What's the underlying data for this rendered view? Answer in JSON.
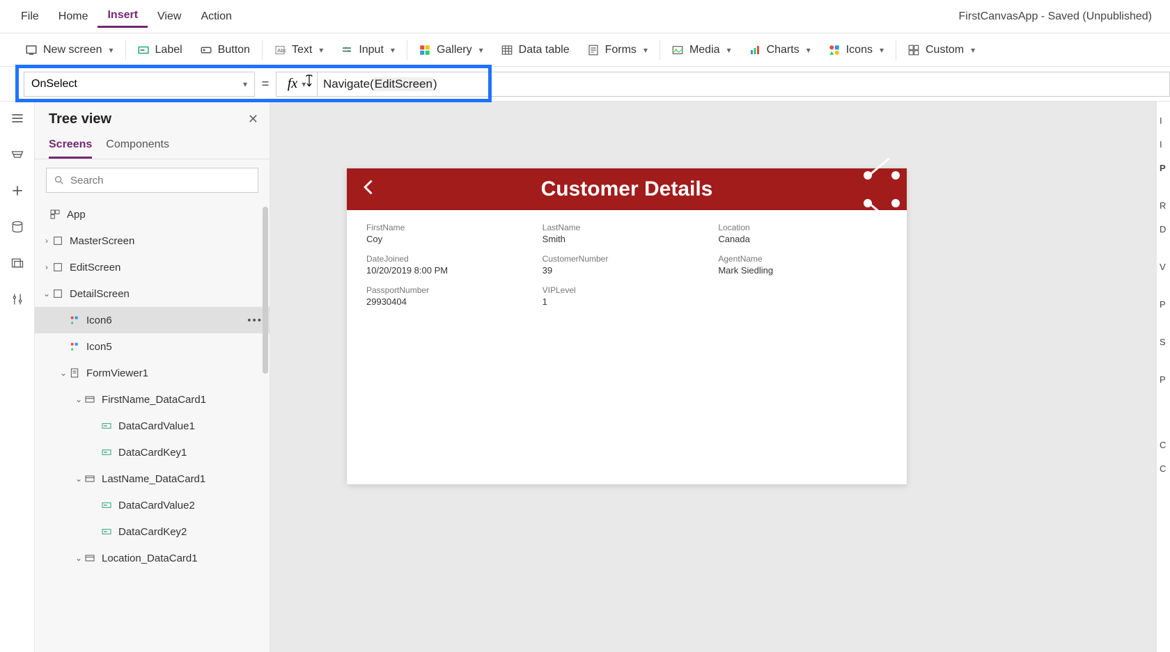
{
  "app_title": "FirstCanvasApp - Saved (Unpublished)",
  "menu": {
    "file": "File",
    "home": "Home",
    "insert": "Insert",
    "view": "View",
    "action": "Action"
  },
  "ribbon": {
    "new_screen": "New screen",
    "label": "Label",
    "button": "Button",
    "text": "Text",
    "input": "Input",
    "gallery": "Gallery",
    "data_table": "Data table",
    "forms": "Forms",
    "media": "Media",
    "charts": "Charts",
    "icons": "Icons",
    "custom": "Custom"
  },
  "formula": {
    "property": "OnSelect",
    "equals": "=",
    "fn_name": "Navigate",
    "arg": "EditScreen"
  },
  "tree": {
    "title": "Tree view",
    "tab_screens": "Screens",
    "tab_components": "Components",
    "search_placeholder": "Search",
    "app": "App",
    "master": "MasterScreen",
    "edit": "EditScreen",
    "detail": "DetailScreen",
    "icon6": "Icon6",
    "icon5": "Icon5",
    "formviewer": "FormViewer1",
    "fn_card": "FirstName_DataCard1",
    "dcv1": "DataCardValue1",
    "dck1": "DataCardKey1",
    "ln_card": "LastName_DataCard1",
    "dcv2": "DataCardValue2",
    "dck2": "DataCardKey2",
    "loc_card": "Location_DataCard1"
  },
  "preview": {
    "title": "Customer Details",
    "fields": {
      "firstname_l": "FirstName",
      "firstname_v": "Coy",
      "lastname_l": "LastName",
      "lastname_v": "Smith",
      "location_l": "Location",
      "location_v": "Canada",
      "datejoined_l": "DateJoined",
      "datejoined_v": "10/20/2019 8:00 PM",
      "custnum_l": "CustomerNumber",
      "custnum_v": "39",
      "agent_l": "AgentName",
      "agent_v": "Mark Siedling",
      "passport_l": "PassportNumber",
      "passport_v": "29930404",
      "vip_l": "VIPLevel",
      "vip_v": "1"
    }
  },
  "right": {
    "r1": "I",
    "r2": "I",
    "r3": "P",
    "r4": "R",
    "r5": "D",
    "r6": "V",
    "r7": "P",
    "r8": "S",
    "r9": "P",
    "r10": "C",
    "r11": "C"
  }
}
